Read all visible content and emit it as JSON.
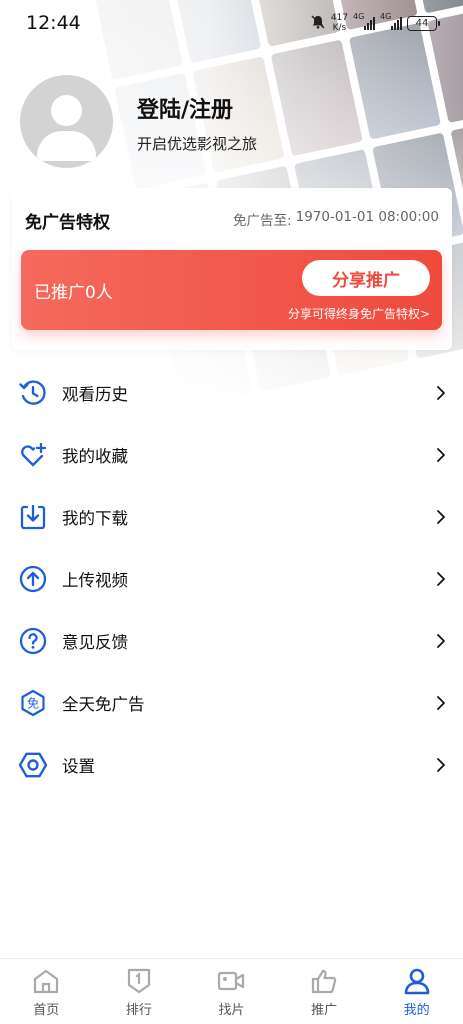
{
  "status": {
    "time": "12:44",
    "net_speed_value": "417",
    "net_speed_unit": "K/s",
    "signal1": "4G",
    "signal2": "4G",
    "battery": "44"
  },
  "profile": {
    "title": "登陆/注册",
    "subtitle": "开启优选影视之旅"
  },
  "vip": {
    "title": "免广告特权",
    "expire_label": "免广告至:",
    "expire_value": "1970-01-01 08:00:00",
    "promo_count": "已推广0人",
    "share_button": "分享推广",
    "promo_hint": "分享可得终身免广告特权>"
  },
  "menu": [
    {
      "label": "观看历史",
      "icon": "history-icon"
    },
    {
      "label": "我的收藏",
      "icon": "heart-plus-icon"
    },
    {
      "label": "我的下载",
      "icon": "download-icon"
    },
    {
      "label": "上传视频",
      "icon": "upload-icon"
    },
    {
      "label": "意见反馈",
      "icon": "feedback-icon"
    },
    {
      "label": "全天免广告",
      "icon": "no-ads-icon"
    },
    {
      "label": "设置",
      "icon": "settings-icon"
    }
  ],
  "menu_icon_glyphs": {
    "no_ads": "免"
  },
  "nav": [
    {
      "label": "首页",
      "icon": "home-icon"
    },
    {
      "label": "排行",
      "icon": "ranking-icon"
    },
    {
      "label": "找片",
      "icon": "video-camera-icon"
    },
    {
      "label": "推广",
      "icon": "thumbs-up-icon"
    },
    {
      "label": "我的",
      "icon": "profile-icon",
      "active": true
    }
  ],
  "colors": {
    "accent_blue": "#1e5fd9",
    "promo_red": "#ef4a3e",
    "promo_red_light": "#f46a5c"
  }
}
